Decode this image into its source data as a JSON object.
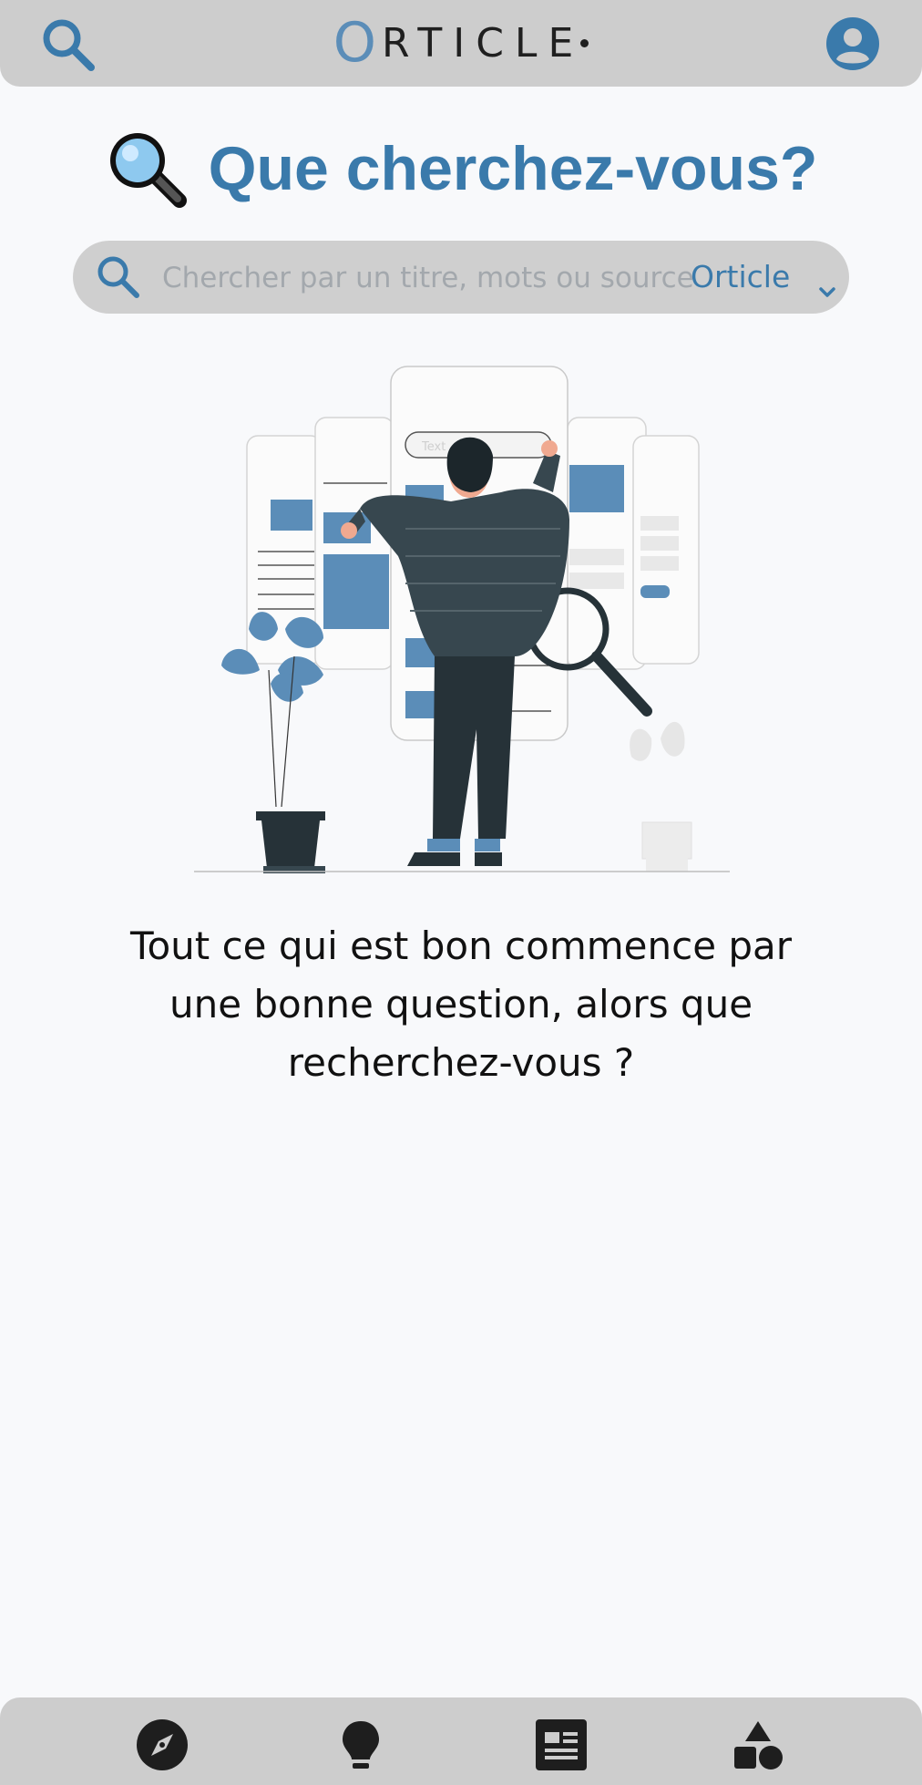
{
  "header": {
    "logo_o": "O",
    "logo_rest": "RTICLE"
  },
  "title": {
    "text": "Que cherchez-vous?"
  },
  "search": {
    "placeholder": "Chercher par un titre, mots ou source",
    "value": "",
    "source_selected": "Orticle"
  },
  "message": {
    "text": "Tout ce qui est bon commence par une bonne question, alors que recherchez-vous ?"
  },
  "illustration": {
    "search_box_text": "Text"
  },
  "nav": {
    "items": [
      "explore-icon",
      "lightbulb-icon",
      "article-icon",
      "categories-icon"
    ]
  },
  "colors": {
    "accent": "#3a7aab",
    "bar_bg": "#cdcdcd",
    "page_bg": "#f8f9fb"
  }
}
